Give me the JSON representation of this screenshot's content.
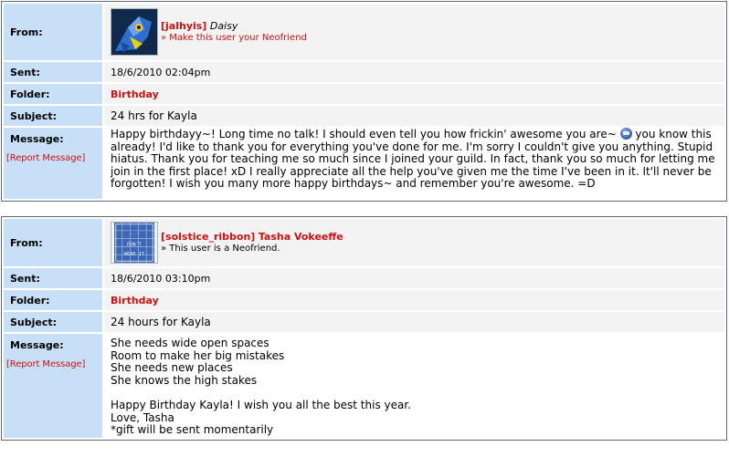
{
  "labels": {
    "from": "From:",
    "sent": "Sent:",
    "folder": "Folder:",
    "subject": "Subject:",
    "message": "Message:",
    "report": "[Report Message]"
  },
  "messages": [
    {
      "from_username": "[jalhyis]",
      "from_display": "Daisy",
      "from_sub": "» Make this user your Neofriend",
      "avatar_icon": "blue-bird-avatar",
      "sent": "18/6/2010 02:04pm",
      "folder": "Birthday",
      "subject": "24 hrs for Kayla",
      "body_part1": "Happy birthdayy~! Long time no talk! I should even tell you how frickin' awesome you are~",
      "smiley_icon": "smiley-icon",
      "body_part2": " you know this already! I'd like to thank you for everything you've done for me. I'm sorry I couldn't give you anything. Stupid hiatus. Thank you for teaching me so much since I joined your guild. In fact, thank you so much for letting me join in the first place! xD I really appreciate all the help you've given me the time I've been in it. It'll never be forgotten! I wish you many more happy birthdays~ and remember you're awesome. =D"
    },
    {
      "from_username": "[solstice_ribbon]",
      "from_display": "Tasha Vokeeffe",
      "from_sub": "» This user is a Neofriend.",
      "avatar_icon": "blue-tile-avatar",
      "avatar_text": [
        "...",
        "DON'T",
        "WEAR IT"
      ],
      "sent": "18/6/2010 03:10pm",
      "folder": "Birthday",
      "subject": "24 hours for Kayla",
      "body_lines": [
        "She needs wide open spaces",
        "Room to make her big mistakes",
        "She needs new places",
        "She knows the high stakes",
        "",
        "Happy Birthday Kayla! I wish you all the best this year.",
        "Love, Tasha",
        "*gift will be sent momentarily"
      ]
    }
  ],
  "colors": {
    "label_bg": "#c8dff8",
    "value_bg": "#f3f3f3",
    "accent_red": "#cc1111",
    "border": "#5f6b7a"
  }
}
